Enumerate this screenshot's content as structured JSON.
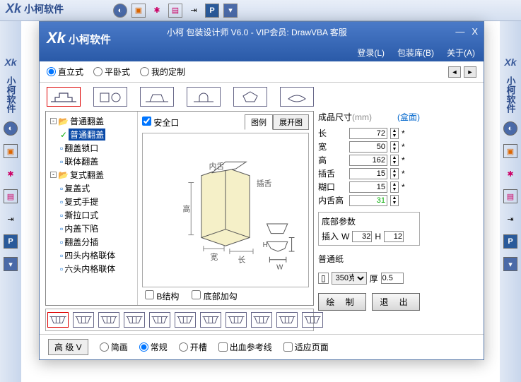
{
  "bg": {
    "brand": "Xk",
    "brand_text": "小柯软件"
  },
  "window": {
    "title": "小柯 包装设计师 V6.0 - VIP会员: DrawVBA 客服",
    "brand": "Xk",
    "brand_text": "小柯软件",
    "menus": {
      "login": "登录(L)",
      "lib": "包装库(B)",
      "about": "关于(A)"
    }
  },
  "mode": {
    "opts": [
      "直立式",
      "平卧式",
      "我的定制"
    ],
    "selected": "直立式"
  },
  "shapes_top": [
    "box-a",
    "box-b",
    "box-c",
    "box-d",
    "box-e",
    "box-f"
  ],
  "tree": [
    {
      "lvl": 0,
      "exp": "-",
      "type": "fold",
      "label": "普通翻盖"
    },
    {
      "lvl": 1,
      "exp": "",
      "type": "check",
      "label": "普通翻盖",
      "sel": true
    },
    {
      "lvl": 1,
      "exp": "",
      "type": "leaf",
      "label": "翻盖锁口"
    },
    {
      "lvl": 1,
      "exp": "",
      "type": "leaf",
      "label": "联体翻盖"
    },
    {
      "lvl": 0,
      "exp": "-",
      "type": "fold",
      "label": "复式翻盖"
    },
    {
      "lvl": 1,
      "exp": "",
      "type": "leaf",
      "label": "复盖式"
    },
    {
      "lvl": 1,
      "exp": "",
      "type": "leaf",
      "label": "复式手提"
    },
    {
      "lvl": 1,
      "exp": "",
      "type": "leaf",
      "label": "撕拉口式"
    },
    {
      "lvl": 1,
      "exp": "",
      "type": "leaf",
      "label": "内盖下陷"
    },
    {
      "lvl": 1,
      "exp": "",
      "type": "leaf",
      "label": "翻盖分插"
    },
    {
      "lvl": 1,
      "exp": "",
      "type": "leaf",
      "label": "四头内格联体"
    },
    {
      "lvl": 1,
      "exp": "",
      "type": "leaf",
      "label": "六头内格联体"
    }
  ],
  "preview": {
    "safe": "安全口",
    "tabs": [
      "图例",
      "展开图"
    ],
    "active_tab": "图例",
    "labels": {
      "inner": "内舌",
      "insert": "插舌",
      "height": "高",
      "width": "宽",
      "length": "长",
      "H": "H",
      "W": "W"
    },
    "checks": {
      "b": "B结构",
      "bottom": "底部加勾"
    }
  },
  "dims": {
    "header": "成品尺寸",
    "unit": "(mm)",
    "view": "(盒面)",
    "rows": [
      {
        "label": "长",
        "val": "72",
        "star": true
      },
      {
        "label": "宽",
        "val": "50",
        "star": true
      },
      {
        "label": "高",
        "val": "162",
        "star": true
      },
      {
        "label": "插舌",
        "val": "15",
        "star": true
      },
      {
        "label": "糊口",
        "val": "15",
        "star": true
      },
      {
        "label": "内舌高",
        "val": "31",
        "star": false,
        "green": true
      }
    ]
  },
  "bottom_params": {
    "title": "底部参数",
    "insert": "插入",
    "W": "W",
    "w_val": "32",
    "H": "H",
    "h_val": "12"
  },
  "paper": {
    "type": "普通纸",
    "weight": "350克",
    "thick_label": "厚",
    "thick": "0.5"
  },
  "actions": {
    "draw": "绘 制",
    "exit": "退 出"
  },
  "bottom": {
    "adv": "高 级 V",
    "render_opts": [
      "简画",
      "常规",
      "开槽"
    ],
    "render_sel": "常规",
    "bleed": "出血参考线",
    "fit": "适应页面"
  }
}
